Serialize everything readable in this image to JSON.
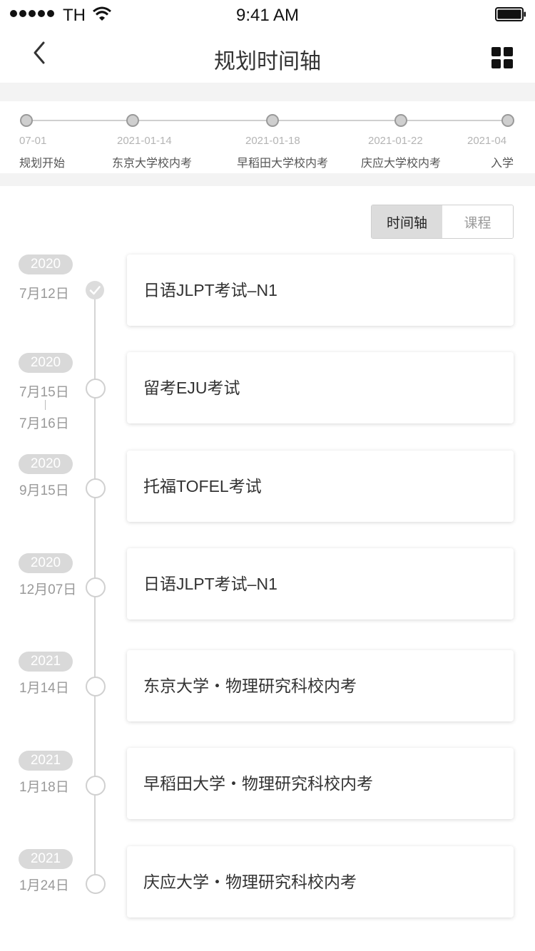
{
  "status_bar": {
    "carrier": "TH",
    "time": "9:41 AM"
  },
  "nav": {
    "title": "规划时间轴"
  },
  "milestones": [
    {
      "date": "07-01",
      "name": "规划开始"
    },
    {
      "date": "2021-01-14",
      "name": "东京大学校内考"
    },
    {
      "date": "2021-01-18",
      "name": "早稻田大学校内考"
    },
    {
      "date": "2021-01-22",
      "name": "庆应大学校内考"
    },
    {
      "date": "2021-04",
      "name": "入学"
    }
  ],
  "tabs": {
    "active": "时间轴",
    "inactive": "课程"
  },
  "events": [
    {
      "year": "2020",
      "date": "7月12日",
      "title": "日语JLPT考试–N1",
      "done": true
    },
    {
      "year": "2020",
      "date": "7月15日",
      "date_end": "7月16日",
      "title": "留考EJU考试",
      "done": false
    },
    {
      "year": "2020",
      "date": "9月15日",
      "title": "托福TOFEL考试",
      "done": false
    },
    {
      "year": "2020",
      "date": "12月07日",
      "title": "日语JLPT考试–N1",
      "done": false
    },
    {
      "year": "2021",
      "date": "1月14日",
      "title": "东京大学・物理研究科校内考",
      "done": false
    },
    {
      "year": "2021",
      "date": "1月18日",
      "title": "早稻田大学・物理研究科校内考",
      "done": false
    },
    {
      "year": "2021",
      "date": "1月24日",
      "title": "庆应大学・物理研究科校内考",
      "done": false
    }
  ]
}
